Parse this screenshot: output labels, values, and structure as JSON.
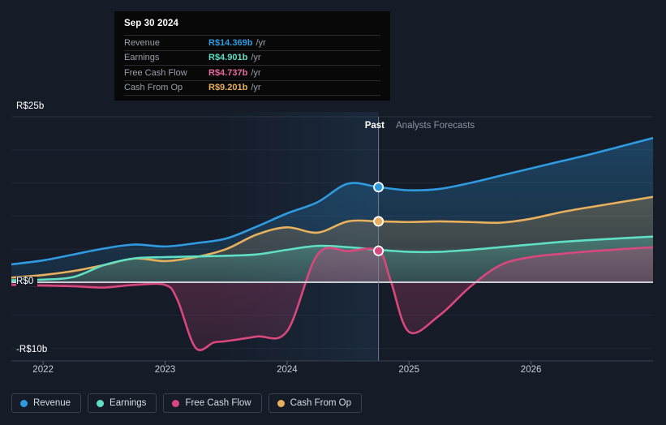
{
  "chart_data": {
    "type": "area",
    "title": "",
    "xlabel": "",
    "ylabel": "",
    "currency": "R$",
    "grid": true,
    "legend_position": "bottom-left",
    "ylim": [
      -12.5,
      26
    ],
    "y_ticks": [
      {
        "label": "R$25b",
        "value": 25
      },
      {
        "label": "R$0",
        "value": 0
      },
      {
        "label": "-R$10b",
        "value": -10
      }
    ],
    "x_ticks": [
      {
        "label": "2022",
        "value": 2022
      },
      {
        "label": "2023",
        "value": 2023
      },
      {
        "label": "2024",
        "value": 2024
      },
      {
        "label": "2025",
        "value": 2025
      },
      {
        "label": "2026",
        "value": 2026
      }
    ],
    "x_range": [
      2021.74,
      2027.0
    ],
    "forecast_start": 2024.75,
    "series": [
      {
        "name": "Revenue",
        "color": "#2f9ae0",
        "x": [
          2021.74,
          2022.0,
          2022.25,
          2022.5,
          2022.75,
          2023.0,
          2023.25,
          2023.5,
          2023.75,
          2024.0,
          2024.25,
          2024.5,
          2024.75,
          2025.0,
          2025.25,
          2025.5,
          2025.75,
          2026.0,
          2026.25,
          2026.5,
          2027.0
        ],
        "values": [
          2.7,
          3.3,
          4.2,
          5.1,
          5.7,
          5.4,
          5.9,
          6.6,
          8.4,
          10.4,
          12.1,
          14.9,
          14.369,
          13.9,
          14.1,
          15.0,
          16.1,
          17.2,
          18.3,
          19.4,
          21.8
        ]
      },
      {
        "name": "Earnings",
        "color": "#5fdfc4",
        "x": [
          2021.74,
          2022.0,
          2022.25,
          2022.5,
          2022.75,
          2023.0,
          2023.25,
          2023.5,
          2023.75,
          2024.0,
          2024.25,
          2024.5,
          2024.75,
          2025.0,
          2025.25,
          2025.5,
          2025.75,
          2026.0,
          2026.25,
          2026.5,
          2027.0
        ],
        "values": [
          0.3,
          0.4,
          0.8,
          2.6,
          3.6,
          3.8,
          3.9,
          4.0,
          4.2,
          4.9,
          5.5,
          5.3,
          4.901,
          4.6,
          4.6,
          4.9,
          5.3,
          5.7,
          6.1,
          6.4,
          6.9
        ]
      },
      {
        "name": "Free Cash Flow",
        "color": "#d9477f",
        "x": [
          2021.74,
          2022.0,
          2022.25,
          2022.5,
          2022.75,
          2023.0,
          2023.1,
          2023.25,
          2023.4,
          2023.5,
          2023.75,
          2024.0,
          2024.25,
          2024.5,
          2024.75,
          2024.85,
          2025.0,
          2025.25,
          2025.5,
          2025.75,
          2026.0,
          2026.25,
          2026.5,
          2027.0
        ],
        "values": [
          -0.4,
          -0.5,
          -0.6,
          -0.8,
          -0.4,
          -0.4,
          -2.6,
          -9.9,
          -9.1,
          -8.9,
          -8.2,
          -7.4,
          4.2,
          4.7,
          4.737,
          0.2,
          -7.5,
          -5.0,
          -0.7,
          2.6,
          3.8,
          4.3,
          4.7,
          5.3
        ]
      },
      {
        "name": "Cash From Op",
        "color": "#e8b05c",
        "x": [
          2021.74,
          2022.0,
          2022.25,
          2022.5,
          2022.75,
          2023.0,
          2023.25,
          2023.5,
          2023.75,
          2024.0,
          2024.25,
          2024.5,
          2024.75,
          2025.0,
          2025.25,
          2025.5,
          2025.75,
          2026.0,
          2026.25,
          2026.5,
          2027.0
        ],
        "values": [
          0.7,
          1.1,
          1.7,
          2.6,
          3.6,
          3.2,
          3.8,
          5.0,
          7.2,
          8.3,
          7.5,
          9.2,
          9.201,
          9.1,
          9.2,
          9.1,
          9.0,
          9.6,
          10.6,
          11.4,
          12.9
        ]
      }
    ],
    "markers": [
      {
        "series": "Revenue",
        "x": 2024.75,
        "value": 14.369,
        "color": "#2f9ae0"
      },
      {
        "series": "Cash From Op",
        "x": 2024.75,
        "value": 9.201,
        "color": "#e8b05c"
      },
      {
        "series": "Free Cash Flow",
        "x": 2024.75,
        "value": 4.737,
        "color": "#d9477f"
      }
    ],
    "bands": [
      {
        "label": "Past",
        "from": 2023.4,
        "to": 2024.75,
        "style": "highlight"
      }
    ]
  },
  "axis": {
    "y_top": "R$25b",
    "y_zero": "R$0",
    "y_neg": "-R$10b",
    "x": [
      "2022",
      "2023",
      "2024",
      "2025",
      "2026"
    ]
  },
  "regions": {
    "past_label": "Past",
    "forecast_label": "Analysts Forecasts"
  },
  "tooltip": {
    "date": "Sep 30 2024",
    "unit": "/yr",
    "rows": [
      {
        "label": "Revenue",
        "value": "R$14.369b",
        "color": "#2f9ae0"
      },
      {
        "label": "Earnings",
        "value": "R$4.901b",
        "color": "#5fdfc4"
      },
      {
        "label": "Free Cash Flow",
        "value": "R$4.737b",
        "color": "#e8679f"
      },
      {
        "label": "Cash From Op",
        "value": "R$9.201b",
        "color": "#e8b05c"
      }
    ]
  },
  "legend": {
    "items": [
      {
        "label": "Revenue",
        "color": "#2f9ae0"
      },
      {
        "label": "Earnings",
        "color": "#5fdfc4"
      },
      {
        "label": "Free Cash Flow",
        "color": "#d9477f"
      },
      {
        "label": "Cash From Op",
        "color": "#e8b05c"
      }
    ]
  }
}
